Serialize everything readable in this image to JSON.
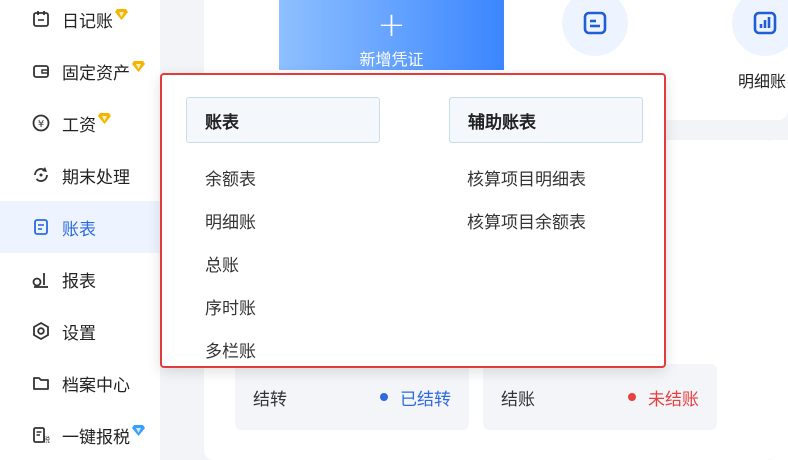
{
  "sidebar": {
    "items": [
      {
        "label": "日记账",
        "icon": "calendar-icon",
        "premium": true
      },
      {
        "label": "固定资产",
        "icon": "wallet-icon",
        "premium": true
      },
      {
        "label": "工资",
        "icon": "yuan-coin-icon",
        "premium": true
      },
      {
        "label": "期末处理",
        "icon": "refresh-icon",
        "premium": false
      },
      {
        "label": "账表",
        "icon": "ledger-icon",
        "premium": false,
        "active": true
      },
      {
        "label": "报表",
        "icon": "report-icon",
        "premium": false
      },
      {
        "label": "设置",
        "icon": "settings-icon",
        "premium": false
      },
      {
        "label": "档案中心",
        "icon": "folder-icon",
        "premium": false
      },
      {
        "label": "一键报税",
        "icon": "tax-icon",
        "premium": true
      }
    ],
    "active_color": "#2d6ae0",
    "premium_color": "#f5b400"
  },
  "toolbar": {
    "new_voucher_plus": "+",
    "new_voucher_label": "新增凭证",
    "detail_ledger_label": "明细账"
  },
  "dropdown": {
    "border_color": "#e23b3b",
    "ledger_header": "账表",
    "ledger_items": [
      "余额表",
      "明细账",
      "总账",
      "序时账",
      "多栏账"
    ],
    "aux_header": "辅助账表",
    "aux_items": [
      "核算项目明细表",
      "核算项目余额表"
    ]
  },
  "status": {
    "carry_forward_label": "结转",
    "carry_forward_state": "已结转",
    "carry_forward_color": "#2d6ae0",
    "close_label": "结账",
    "close_state": "未结账",
    "close_color": "#e84040"
  }
}
